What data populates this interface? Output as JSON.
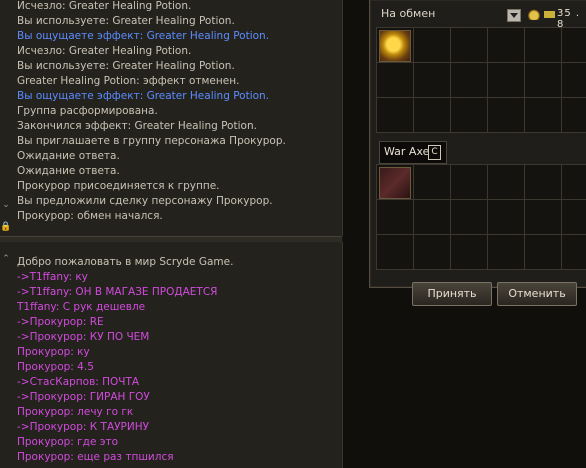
{
  "system_chat": {
    "lines": [
      {
        "text": "Исчезло: Greater Healing Potion.",
        "color": "white"
      },
      {
        "text": "Вы используете: Greater Healing Potion.",
        "color": "white"
      },
      {
        "text": "Вы ощущаете эффект: Greater Healing Potion.",
        "color": "blue"
      },
      {
        "text": "Исчезло: Greater Healing Potion.",
        "color": "white"
      },
      {
        "text": "Вы используете: Greater Healing Potion.",
        "color": "white"
      },
      {
        "text": "Greater Healing Potion: эффект отменен.",
        "color": "white"
      },
      {
        "text": "Вы ощущаете эффект: Greater Healing Potion.",
        "color": "blue"
      },
      {
        "text": "Группа расформирована.",
        "color": "white"
      },
      {
        "text": "Закончился эффект: Greater Healing Potion.",
        "color": "white"
      },
      {
        "text": "Вы приглашаете в группу персонажа Прокурор.",
        "color": "white"
      },
      {
        "text": "Ожидание ответа.",
        "color": "white"
      },
      {
        "text": "Ожидание ответа.",
        "color": "white"
      },
      {
        "text": "Прокурор присоединяется к группе.",
        "color": "white"
      },
      {
        "text": "Вы предложили сделку персонажу Прокурор.",
        "color": "white"
      },
      {
        "text": "Прокурор: обмен начался.",
        "color": "white"
      }
    ]
  },
  "general_chat": {
    "lines": [
      {
        "text": "Добро пожаловать в мир Scryde Game.",
        "color": "white"
      },
      {
        "text": "->T1ffany: ку",
        "color": "magenta"
      },
      {
        "text": "->T1ffany: ОН В МАГАЗЕ ПРОДАЕТСЯ",
        "color": "magenta"
      },
      {
        "text": "T1ffany: С рук дешевле",
        "color": "magenta"
      },
      {
        "text": "->Прокурор: RE",
        "color": "magenta"
      },
      {
        "text": "->Прокурор: КУ ПО ЧЕМ",
        "color": "magenta"
      },
      {
        "text": "Прокурор: ку",
        "color": "magenta"
      },
      {
        "text": "Прокурор: 4.5",
        "color": "magenta"
      },
      {
        "text": "->СтасКарпов: ПОЧТА",
        "color": "magenta"
      },
      {
        "text": "->Прокурор: ГИРАН ГОУ",
        "color": "magenta"
      },
      {
        "text": "Прокурор: лечу го гк",
        "color": "magenta"
      },
      {
        "text": "->Прокурор: К ТАУРИНУ",
        "color": "magenta"
      },
      {
        "text": "Прокурор: где это",
        "color": "magenta"
      },
      {
        "text": "Прокурор: еще раз тпшился",
        "color": "magenta"
      }
    ]
  },
  "trade": {
    "title": "На обмен",
    "adena": "35 . 8",
    "offer_item_icon": "gold-pouch-icon",
    "item_label": "War Axe",
    "item_grade": "C",
    "received_item_icon": "war-axe-icon",
    "accept_label": "Принять",
    "cancel_label": "Отменить"
  },
  "colors": {
    "white": "#c9c3b6",
    "blue": "#5c8cff",
    "magenta": "#d24bde"
  }
}
